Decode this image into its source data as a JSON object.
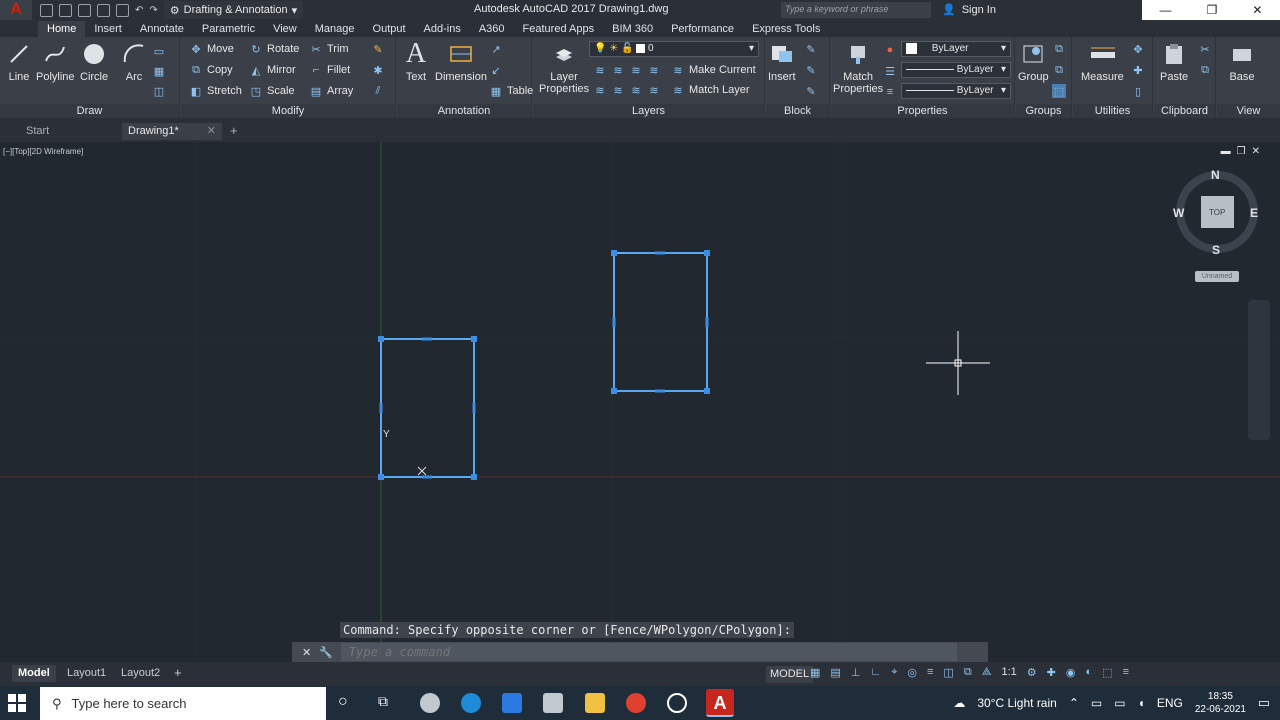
{
  "titlebar": {
    "workspace": "Drafting & Annotation",
    "doc_title": "Autodesk AutoCAD 2017    Drawing1.dwg",
    "search_placeholder": "Type a keyword or phrase",
    "signin": "Sign In"
  },
  "ribbon_tabs": [
    "Home",
    "Insert",
    "Annotate",
    "Parametric",
    "View",
    "Manage",
    "Output",
    "Add-ins",
    "A360",
    "Featured Apps",
    "BIM 360",
    "Performance",
    "Express Tools"
  ],
  "panels": {
    "draw": {
      "title": "Draw",
      "line": "Line",
      "polyline": "Polyline",
      "circle": "Circle",
      "arc": "Arc"
    },
    "modify": {
      "title": "Modify",
      "move": "Move",
      "rotate": "Rotate",
      "trim": "Trim",
      "copy": "Copy",
      "mirror": "Mirror",
      "fillet": "Fillet",
      "stretch": "Stretch",
      "scale": "Scale",
      "array": "Array"
    },
    "annotation": {
      "title": "Annotation",
      "text": "Text",
      "dimension": "Dimension",
      "table": "Table"
    },
    "layers": {
      "title": "Layers",
      "layer_properties_1": "Layer",
      "layer_properties_2": "Properties",
      "current_layer": "0",
      "make_current": "Make Current",
      "match_layer": "Match Layer"
    },
    "block": {
      "title": "Block",
      "insert": "Insert"
    },
    "properties": {
      "title": "Properties",
      "match_1": "Match",
      "match_2": "Properties",
      "color": "ByLayer",
      "linetype": "ByLayer",
      "lineweight": "ByLayer"
    },
    "groups": {
      "title": "Groups",
      "group": "Group"
    },
    "utilities": {
      "title": "Utilities",
      "measure": "Measure"
    },
    "clipboard": {
      "title": "Clipboard",
      "paste": "Paste"
    },
    "view": {
      "title": "View",
      "base": "Base"
    }
  },
  "doc_tabs": {
    "start": "Start",
    "drawing": "Drawing1*"
  },
  "viewport": {
    "label": "[−][Top][2D Wireframe]",
    "viewcube": {
      "north": "N",
      "south": "S",
      "east": "E",
      "west": "W",
      "face": "TOP",
      "ucs": "Unnamed"
    },
    "ucs_y": "Y"
  },
  "command": {
    "history": "Command: Specify opposite corner or [Fence/WPolygon/CPolygon]:",
    "placeholder": "Type a command"
  },
  "layout_tabs": [
    "Model",
    "Layout1",
    "Layout2"
  ],
  "status": {
    "model": "MODEL",
    "scale": "1:1"
  },
  "taskbar": {
    "search": "Type here to search",
    "weather": "30°C  Light rain",
    "lang": "ENG",
    "time": "18:35",
    "date": "22-06-2021"
  },
  "colors": {
    "accent": "#4aa3f0",
    "canvas": "#212830",
    "autocad_red": "#d81e05"
  }
}
